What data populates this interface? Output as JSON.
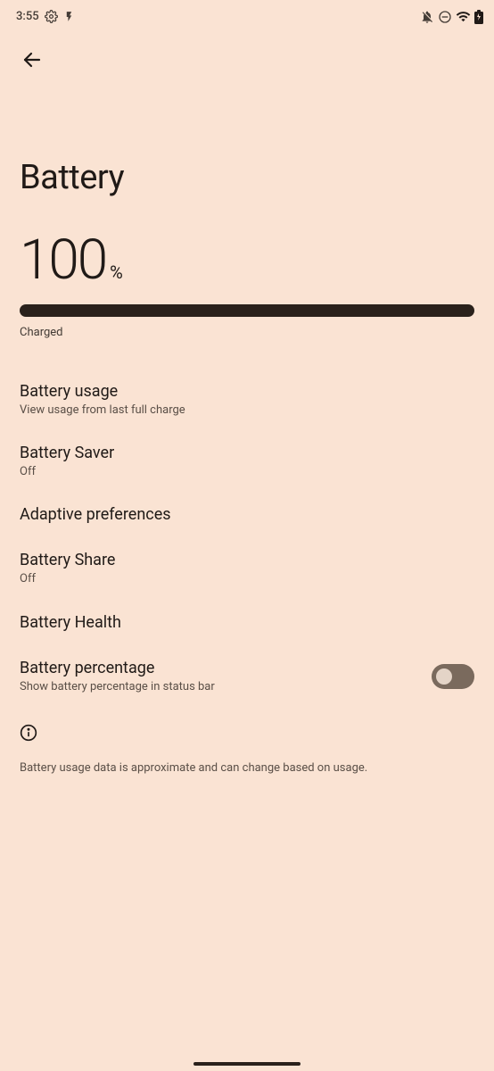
{
  "status_bar": {
    "time": "3:55"
  },
  "page": {
    "title": "Battery"
  },
  "battery": {
    "value": "100",
    "unit": "%",
    "status": "Charged"
  },
  "settings": [
    {
      "title": "Battery usage",
      "subtitle": "View usage from last full charge"
    },
    {
      "title": "Battery Saver",
      "subtitle": "Off"
    },
    {
      "title": "Adaptive preferences",
      "subtitle": ""
    },
    {
      "title": "Battery Share",
      "subtitle": "Off"
    },
    {
      "title": "Battery Health",
      "subtitle": ""
    },
    {
      "title": "Battery percentage",
      "subtitle": "Show battery percentage in status bar"
    }
  ],
  "footer": {
    "info": "Battery usage data is approximate and can change based on usage."
  }
}
